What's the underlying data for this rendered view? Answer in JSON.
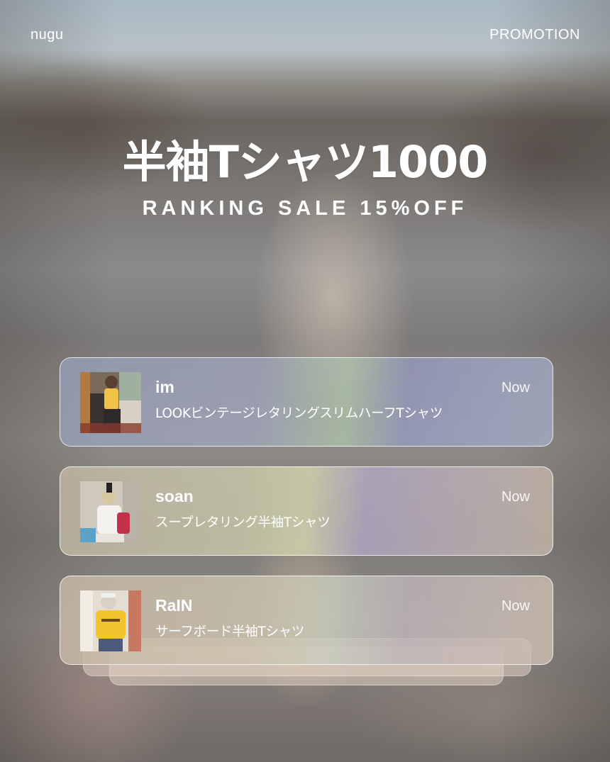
{
  "header": {
    "brand": "nugu",
    "promotion_label": "PROMOTION"
  },
  "hero": {
    "title": "半袖Tシャツ1000",
    "subtitle": "RANKING SALE 15%OFF"
  },
  "notifications": [
    {
      "name": "im",
      "time": "Now",
      "text": "LOOKビンテージレタリングスリムハーフTシャツ"
    },
    {
      "name": "soan",
      "time": "Now",
      "text": "スープレタリング半袖Tシャツ"
    },
    {
      "name": "RaIN",
      "time": "Now",
      "text": "サーフボード半袖Tシャツ"
    }
  ],
  "colors": {
    "text": "#ffffff"
  }
}
